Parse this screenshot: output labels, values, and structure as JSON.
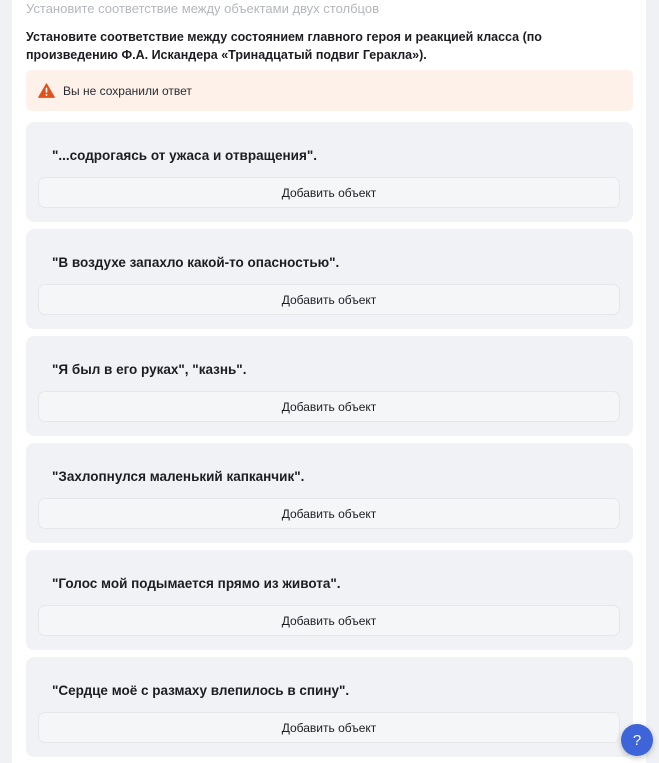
{
  "task": {
    "subtitle": "Установите соответствие между объектами двух столбцов",
    "instruction": "Установите соответствие между состоянием главного героя и реакцией класса (по произведению Ф.А. Искандера «Тринадцатый подвиг Геракла»)."
  },
  "warning": {
    "icon": "warning-triangle-icon",
    "text": "Вы не сохранили ответ",
    "color": "#e0531c",
    "background": "#fdf1ea"
  },
  "items": [
    {
      "phrase": "\"...содрогаясь от ужаса и отвращения\".",
      "button_label": "Добавить объект"
    },
    {
      "phrase": "\"В воздухе запахло какой-то опасностью\".",
      "button_label": "Добавить объект"
    },
    {
      "phrase": "\"Я был в его руках\", \"казнь\".",
      "button_label": "Добавить объект"
    },
    {
      "phrase": "\"Захлопнулся маленький капканчик\".",
      "button_label": "Добавить объект"
    },
    {
      "phrase": "\"Голос мой подымается прямо из живота\".",
      "button_label": "Добавить объект"
    },
    {
      "phrase": "\"Сердце моё с размаху влепилось в спину\".",
      "button_label": "Добавить объект"
    }
  ],
  "help": {
    "label": "?",
    "icon": "help-icon",
    "color": "#3d64d8"
  }
}
